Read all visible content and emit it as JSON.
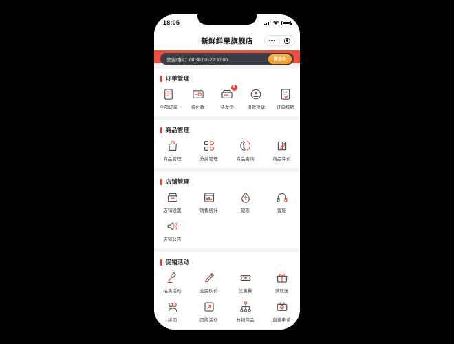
{
  "colors": {
    "accent_red": "#e8402a",
    "header_red": "#ef4f3c",
    "hours_bar_bg": "#3b3d44",
    "badge_orange": "#f79a20",
    "page_bg": "#f4f4f4",
    "card_bg": "#ffffff",
    "outer_bg": "#000000"
  },
  "status_bar": {
    "time": "18:05",
    "signal_icon": "cellular-signal-icon",
    "wifi_icon": "wifi-icon",
    "battery_icon": "battery-icon"
  },
  "nav": {
    "title": "新鲜鲜果旗舰店",
    "menu_icon": "more-dots-icon",
    "target_icon": "target-circle-icon"
  },
  "hours": {
    "text": "营业时间：08:30:00~22:30:00",
    "status_badge": "营业中"
  },
  "sections": [
    {
      "title": "订单管理",
      "columns": 5,
      "items": [
        {
          "label": "全部订单",
          "icon": "all-orders-icon"
        },
        {
          "label": "待付款",
          "icon": "pending-payment-icon"
        },
        {
          "label": "待发货",
          "icon": "pending-shipment-icon",
          "badge": "5"
        },
        {
          "label": "退款投诉",
          "icon": "refund-complaint-icon"
        },
        {
          "label": "订单核销",
          "icon": "order-verification-icon"
        }
      ]
    },
    {
      "title": "商品管理",
      "columns": 4,
      "items": [
        {
          "label": "商品管理",
          "icon": "product-bag-icon"
        },
        {
          "label": "分类管理",
          "icon": "category-grid-icon"
        },
        {
          "label": "商品咨询",
          "icon": "phone-consult-icon"
        },
        {
          "label": "商品评价",
          "icon": "review-edit-icon"
        }
      ]
    },
    {
      "title": "店铺管理",
      "columns": 4,
      "items": [
        {
          "label": "店铺设置",
          "icon": "shop-settings-icon"
        },
        {
          "label": "销售统计",
          "icon": "sales-chart-icon"
        },
        {
          "label": "提现",
          "icon": "withdraw-money-icon"
        },
        {
          "label": "客服",
          "icon": "headset-support-icon"
        },
        {
          "label": "店铺公告",
          "icon": "announcement-speaker-icon"
        }
      ]
    },
    {
      "title": "促销活动",
      "columns": 4,
      "items": [
        {
          "label": "拍卖活动",
          "icon": "auction-gavel-icon"
        },
        {
          "label": "全民砍价",
          "icon": "bargain-knife-icon"
        },
        {
          "label": "优惠券",
          "icon": "coupon-ticket-icon"
        },
        {
          "label": "满就送",
          "icon": "gift-box-icon"
        },
        {
          "label": "拼团",
          "icon": "group-buy-icon"
        },
        {
          "label": "团购活动",
          "icon": "group-deal-icon"
        },
        {
          "label": "分销商品",
          "icon": "distribution-network-icon"
        },
        {
          "label": "直播申请",
          "icon": "livestream-camera-icon"
        }
      ]
    }
  ]
}
